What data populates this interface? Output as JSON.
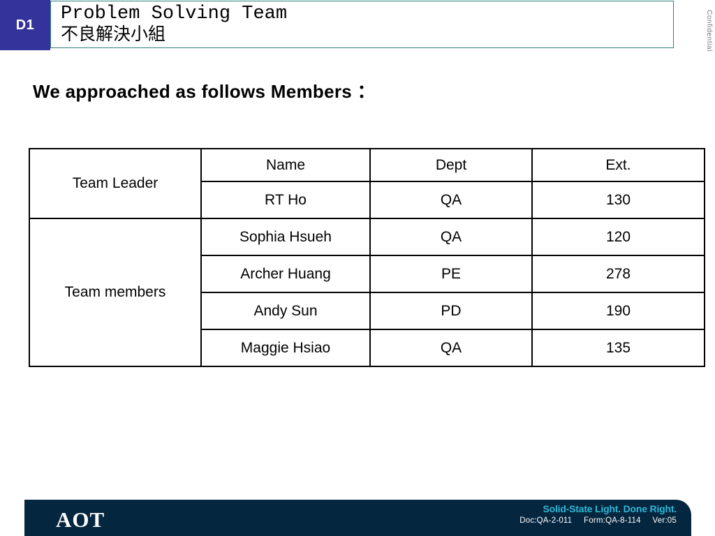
{
  "header": {
    "tag": "D1",
    "title_en": "Problem Solving Team",
    "title_zh": "不良解決小組"
  },
  "confidential": "Confidential",
  "section": {
    "heading": "We approached as follows Members ："
  },
  "table": {
    "columns": [
      "",
      "Name",
      "Dept",
      "Ext."
    ],
    "role_leader": "Team Leader",
    "role_members": "Team members",
    "header_row": {
      "name": "Name",
      "dept": "Dept",
      "ext": "Ext."
    },
    "leader": {
      "name": "RT Ho",
      "dept": "QA",
      "ext": "130"
    },
    "members": [
      {
        "name": "Sophia Hsueh",
        "dept": "QA",
        "ext": "120"
      },
      {
        "name": "Archer Huang",
        "dept": "PE",
        "ext": "278"
      },
      {
        "name": "Andy Sun",
        "dept": "PD",
        "ext": "190"
      },
      {
        "name": "Maggie Hsiao",
        "dept": "QA",
        "ext": "135"
      }
    ]
  },
  "footer": {
    "logo": "AOT",
    "tagline": "Solid-State Light. Done Right.",
    "doc": "Doc:QA-2-011",
    "form": "Form:QA-8-114",
    "ver": "Ver:05"
  },
  "colors": {
    "tag_blue": "#33339B",
    "header_border_teal": "#2F7F7F",
    "footer_navy": "#05263F",
    "tagline_cyan": "#2FB8D8"
  }
}
